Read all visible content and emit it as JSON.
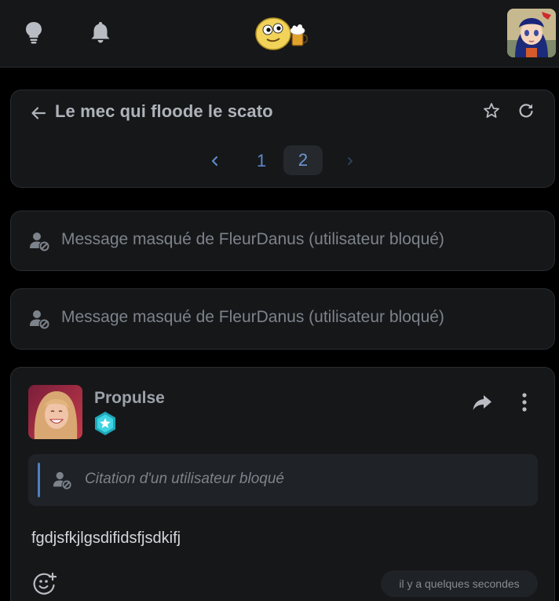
{
  "topbar": {
    "icons": [
      "lightbulb-icon",
      "bell-icon"
    ],
    "logo": "smiley-beer-logo",
    "avatar": "user-avatar"
  },
  "topic": {
    "title": "Le mec qui floode le scato",
    "pagination": {
      "pages": [
        "1",
        "2"
      ],
      "current": "2"
    }
  },
  "hidden_messages": [
    {
      "text": "Message masqué de FleurDanus (utilisateur bloqué)"
    },
    {
      "text": "Message masqué de FleurDanus (utilisateur bloqué)"
    }
  ],
  "post": {
    "author": "Propulse",
    "quote": "Citation d'un utilisateur bloqué",
    "body": "fgdjsfkjlgsdifidsfjsdkifj",
    "time": "il y a quelques secondes"
  },
  "colors": {
    "background": "#000000",
    "card": "#161719",
    "accent": "#5b89c7",
    "muted_text": "#7d838b"
  }
}
